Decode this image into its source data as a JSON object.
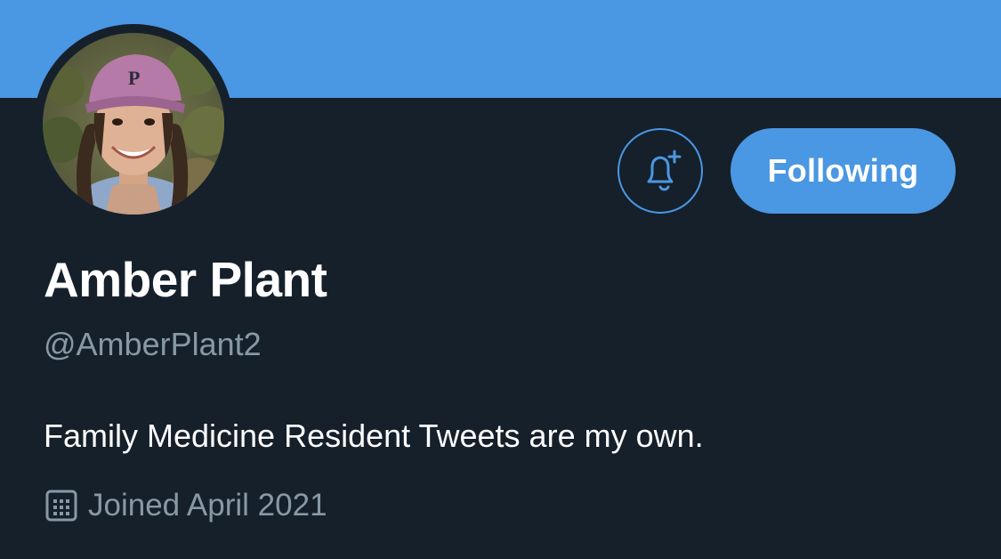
{
  "profile": {
    "display_name": "Amber Plant",
    "handle": "@AmberPlant2",
    "bio": "Family Medicine Resident Tweets are my own.",
    "joined": "Joined April 2021"
  },
  "actions": {
    "notify_icon": "bell-plus-icon",
    "follow_label": "Following"
  },
  "icons": {
    "joined": "calendar-icon"
  },
  "colors": {
    "background": "#15202b",
    "banner": "#4a97e3",
    "accent": "#4a97e3",
    "secondary_text": "#8899a6",
    "primary_text": "#ffffff"
  }
}
